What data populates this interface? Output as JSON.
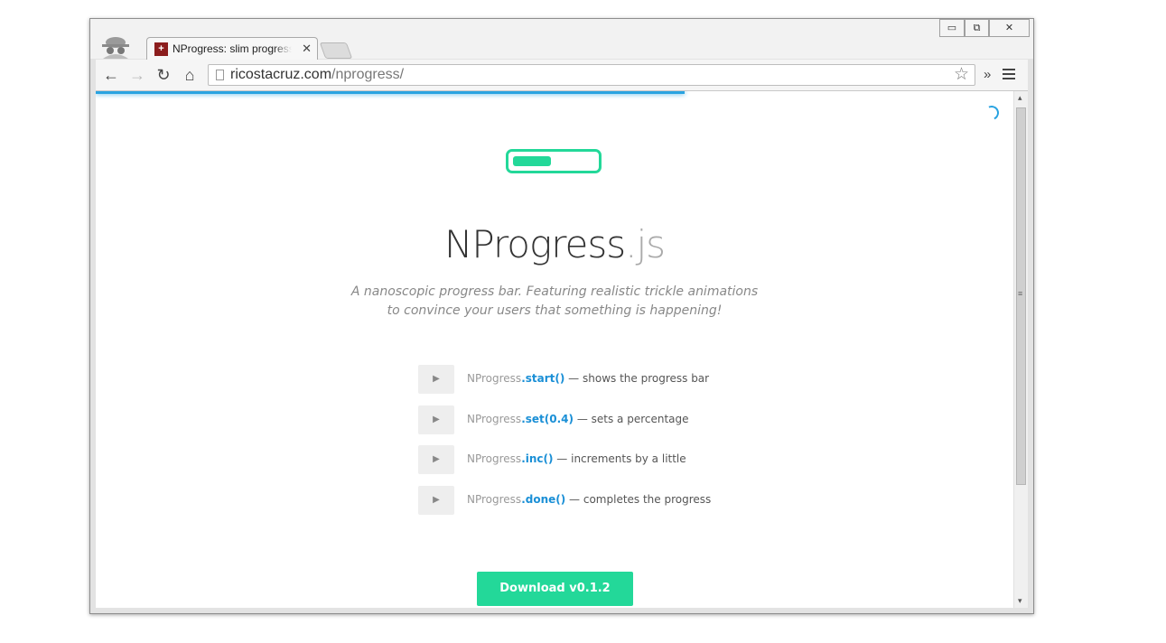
{
  "browser": {
    "tab_title": "NProgress: slim progress bars",
    "tab_close": "✕",
    "url_domain": "ricostacruz.com",
    "url_path": "/nprogress/",
    "star": "☆",
    "overflow_chevron": "»",
    "win_minimize": "▭",
    "win_restore": "⧉",
    "win_close": "✕",
    "favicon_glyph": "+",
    "back": "←",
    "forward": "→",
    "reload": "↻",
    "home": "⌂",
    "scroll_up": "▴",
    "scroll_down": "▾",
    "scroll_grip": "≡"
  },
  "page": {
    "title_main": "NProgress",
    "title_ext": ".js",
    "tagline_line1": "A nanoscopic progress bar. Featuring realistic trickle animations",
    "tagline_line2": "to convince your users that something is happening!",
    "play_icon": "▶",
    "demos": [
      {
        "obj": "NProgress",
        "method": ".start()",
        "desc": " — shows the progress bar"
      },
      {
        "obj": "NProgress",
        "method": ".set(0.4)",
        "desc": " — sets a percentage"
      },
      {
        "obj": "NProgress",
        "method": ".inc()",
        "desc": " — increments by a little"
      },
      {
        "obj": "NProgress",
        "method": ".done()",
        "desc": " — completes the progress"
      }
    ],
    "download_label": "Download v0.1.2"
  },
  "colors": {
    "accent_green": "#23d899",
    "progress_blue": "#29a3e1"
  }
}
